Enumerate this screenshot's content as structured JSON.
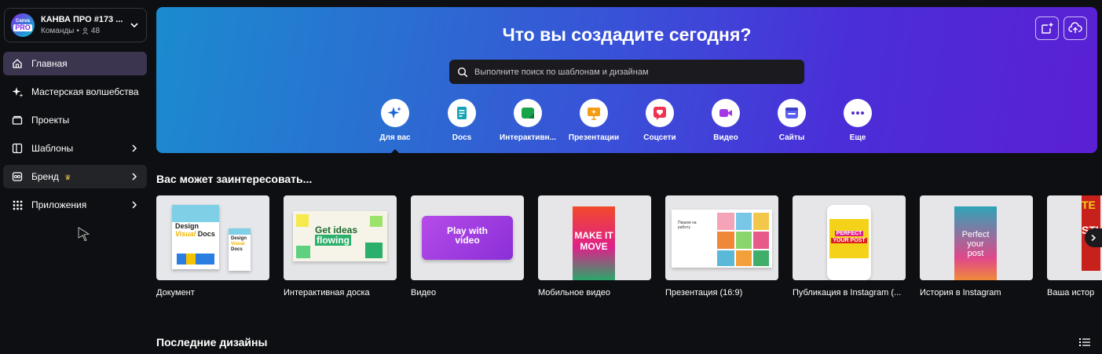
{
  "team": {
    "logo_top": "Canva",
    "logo_badge": "PRO",
    "name": "КАНВА ПРО #173 ...",
    "type": "Команды",
    "separator": "•",
    "members": "48"
  },
  "nav": {
    "items": [
      {
        "label": "Главная",
        "icon": "home-icon"
      },
      {
        "label": "Мастерская волшебства",
        "icon": "sparkle-icon"
      },
      {
        "label": "Проекты",
        "icon": "folder-icon"
      },
      {
        "label": "Шаблоны",
        "icon": "template-icon"
      },
      {
        "label": "Бренд",
        "icon": "brand-icon",
        "badge": "♛"
      },
      {
        "label": "Приложения",
        "icon": "apps-grid-icon"
      }
    ]
  },
  "hero": {
    "title": "Что вы создадите сегодня?",
    "search_placeholder": "Выполните поиск по шаблонам и дизайнам",
    "categories": [
      {
        "label": "Для вас",
        "icon": "sparkle-icon",
        "color": "#1d63d6"
      },
      {
        "label": "Docs",
        "icon": "docs-icon",
        "color": "#13a3b5"
      },
      {
        "label": "Интерактивн...",
        "icon": "whiteboard-icon",
        "color": "#17a34a"
      },
      {
        "label": "Презентации",
        "icon": "presentation-icon",
        "color": "#f29d14"
      },
      {
        "label": "Соцсети",
        "icon": "heart-icon",
        "color": "#f0314f"
      },
      {
        "label": "Видео",
        "icon": "video-icon",
        "color": "#a538e6"
      },
      {
        "label": "Сайты",
        "icon": "website-icon",
        "color": "#5b5ff0"
      },
      {
        "label": "Еще",
        "icon": "more-icon",
        "color": "#5a2fd4"
      }
    ]
  },
  "suggest": {
    "title": "Вас может заинтересовать...",
    "cards": [
      {
        "label": "Документ",
        "art1": "Design",
        "art2": "Visual",
        "art3": "Docs"
      },
      {
        "label": "Интерактивная доска",
        "art1": "Get ideas",
        "art2": "flowing"
      },
      {
        "label": "Видео",
        "art1": "Play with",
        "art2": "video"
      },
      {
        "label": "Мобильное видео",
        "art1": "MAKE IT",
        "art2": "MOVE"
      },
      {
        "label": "Презентация (16:9)",
        "art1": "Пишем на работу"
      },
      {
        "label": "Публикация в Instagram (...",
        "art1": "PERFECT",
        "art2": "YOUR POST"
      },
      {
        "label": "История в Instagram",
        "art1": "Perfect",
        "art2": "your",
        "art3": "post"
      },
      {
        "label": "Ваша истор",
        "art1": "TE",
        "art2": "STI"
      }
    ]
  },
  "recent": {
    "title": "Последние дизайны"
  }
}
